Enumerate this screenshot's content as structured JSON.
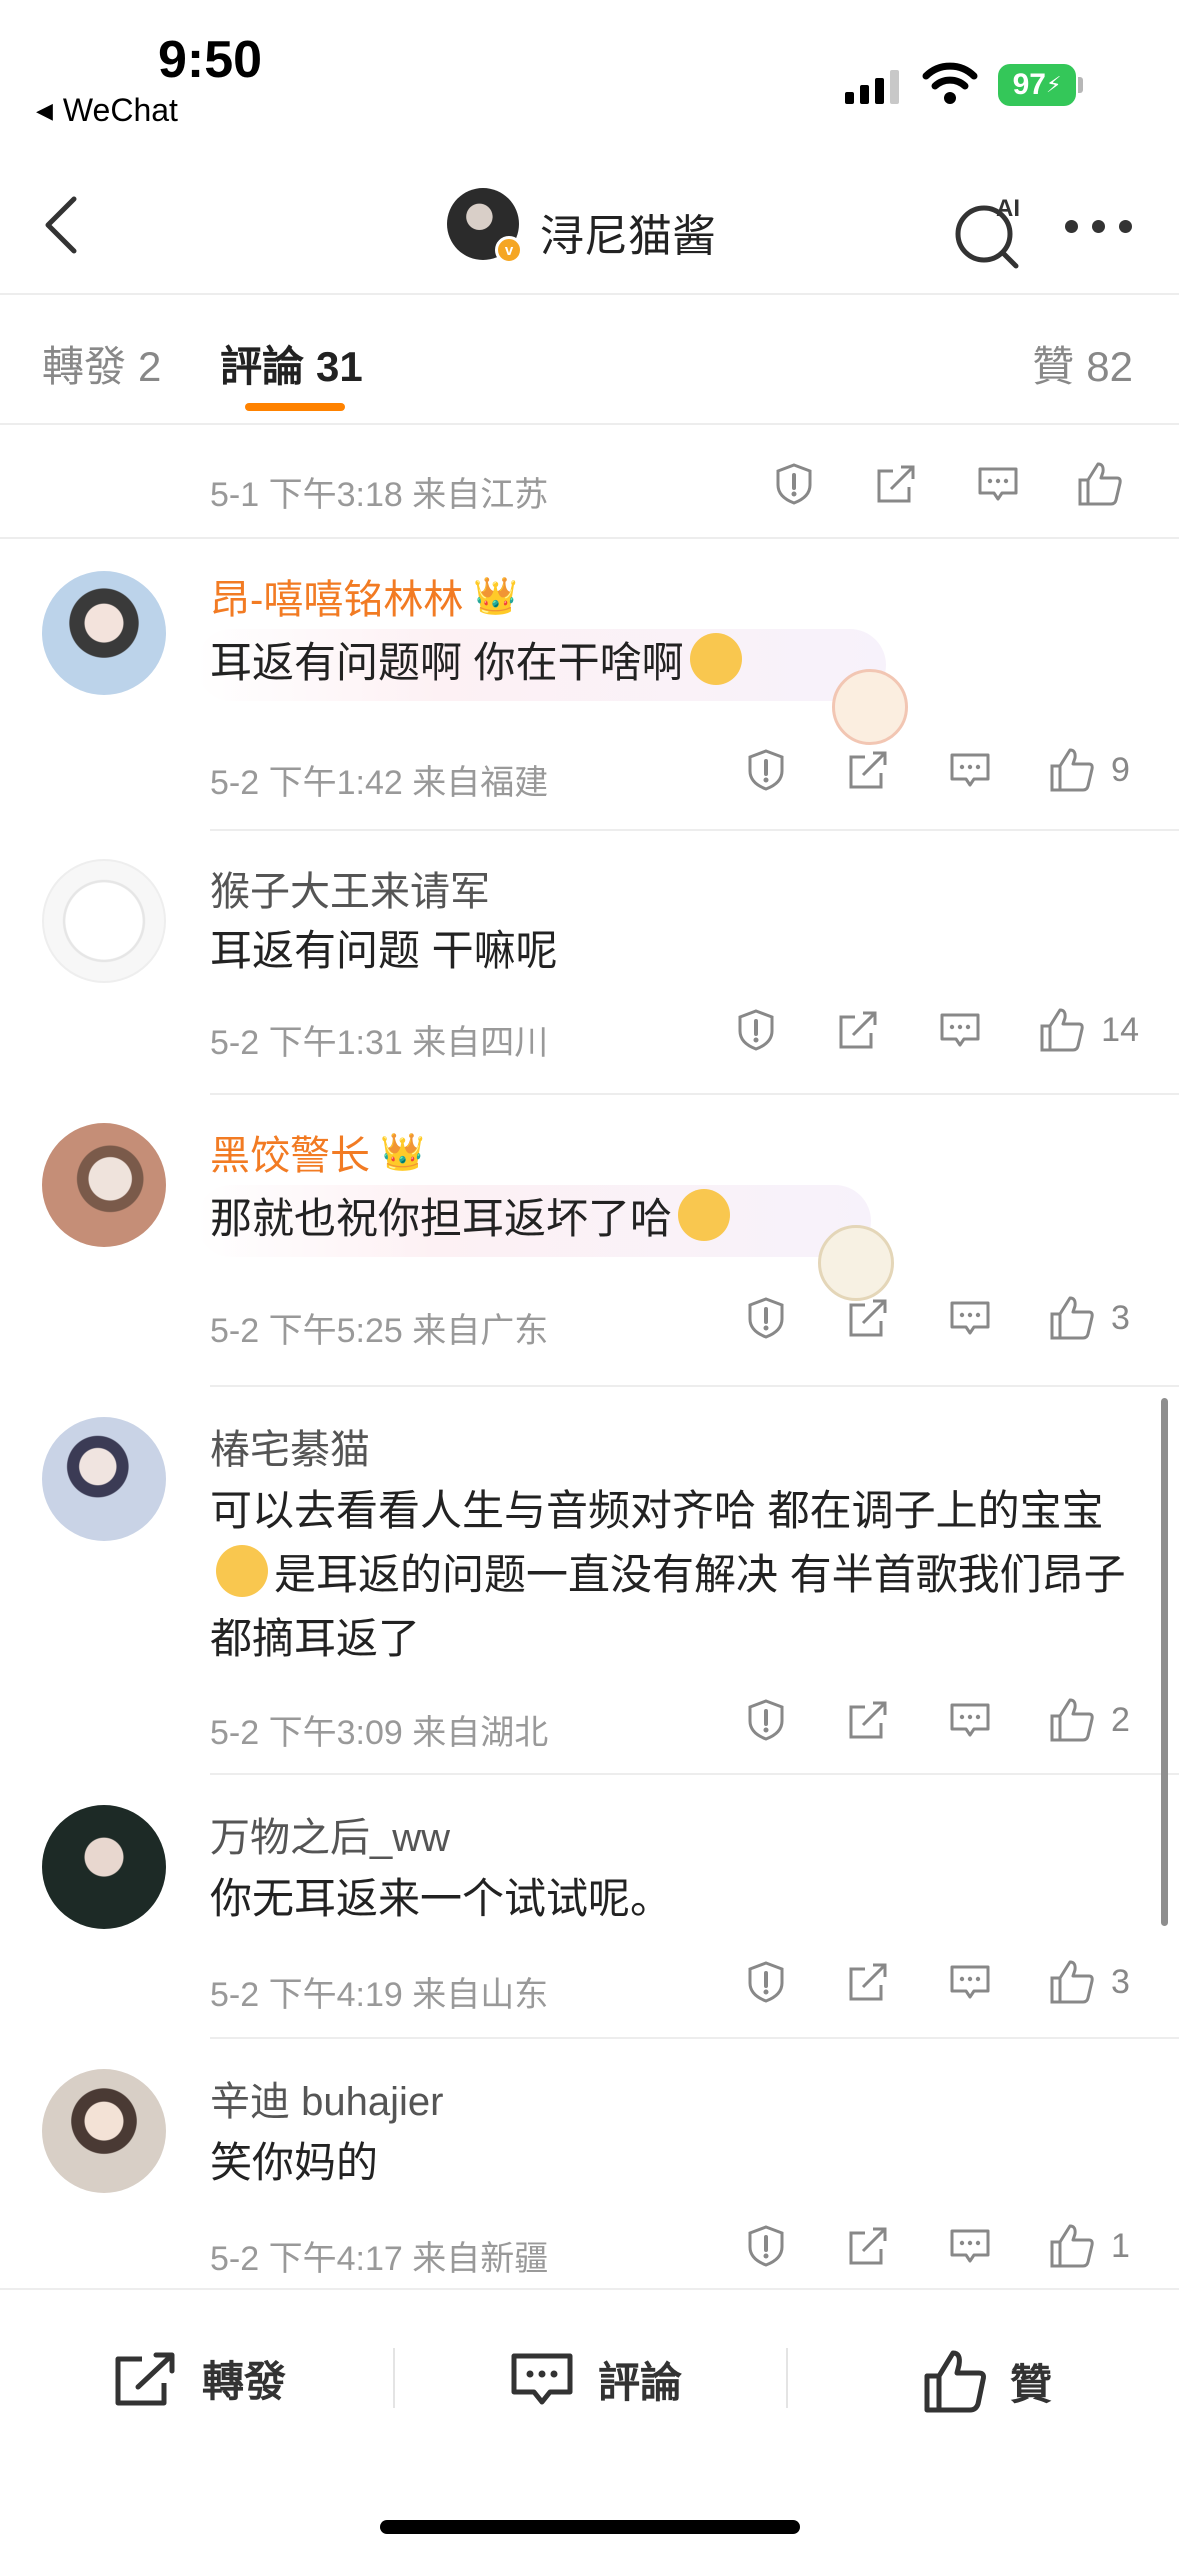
{
  "status_bar": {
    "time": "9:50",
    "back_app": "WeChat",
    "battery": "97"
  },
  "navbar": {
    "title": "浔尼猫酱",
    "ai_label": "AI"
  },
  "tabs": {
    "forward_label": "轉發",
    "forward_count": "2",
    "comment_label": "評論",
    "comment_count": "31",
    "likes_label": "贊",
    "likes_count": "82",
    "accent": "#ff8200"
  },
  "top_partial": {
    "meta": "5-1 下午3:18 来自江苏"
  },
  "comments": [
    {
      "username": "昂-嘻嘻铭林林",
      "vip": true,
      "text": "耳返有问题啊 你在干啥啊",
      "meta": "5-2 下午1:42 来自福建",
      "likes": "9"
    },
    {
      "username": "猴子大王来请军",
      "vip": false,
      "text": "耳返有问题 干嘛呢",
      "meta": "5-2 下午1:31 来自四川",
      "likes": "14"
    },
    {
      "username": "黑饺警长",
      "vip": true,
      "text": "那就也祝你担耳返坏了哈",
      "meta": "5-2 下午5:25 来自广东",
      "likes": "3"
    },
    {
      "username": "椿宅綦猫",
      "vip": false,
      "text_part1": "可以去看看人生与音频对齐哈 都在调子上的宝宝",
      "text_part2": "是耳返的问题一直没有解决 有半首歌我们昂子都摘耳返了",
      "meta": "5-2 下午3:09 来自湖北",
      "likes": "2"
    },
    {
      "username": "万物之后_ww",
      "vip": false,
      "text": "你无耳返来一个试试呢。",
      "meta": "5-2 下午4:19 来自山东",
      "likes": "3"
    },
    {
      "username": "辛迪 buhajier",
      "vip": false,
      "text": "笑你妈的",
      "meta": "5-2 下午4:17 来自新疆",
      "likes": "1"
    }
  ],
  "bottom_bar": {
    "forward": "轉發",
    "comment": "評論",
    "like": "贊"
  },
  "colors": {
    "vip_name": "#f27b23",
    "meta": "#999999",
    "divider": "#ededed"
  },
  "icons": [
    "back-arrow-icon",
    "ai-search-icon",
    "more-icon",
    "report-icon",
    "share-icon",
    "reply-icon",
    "thumbs-up-icon"
  ]
}
